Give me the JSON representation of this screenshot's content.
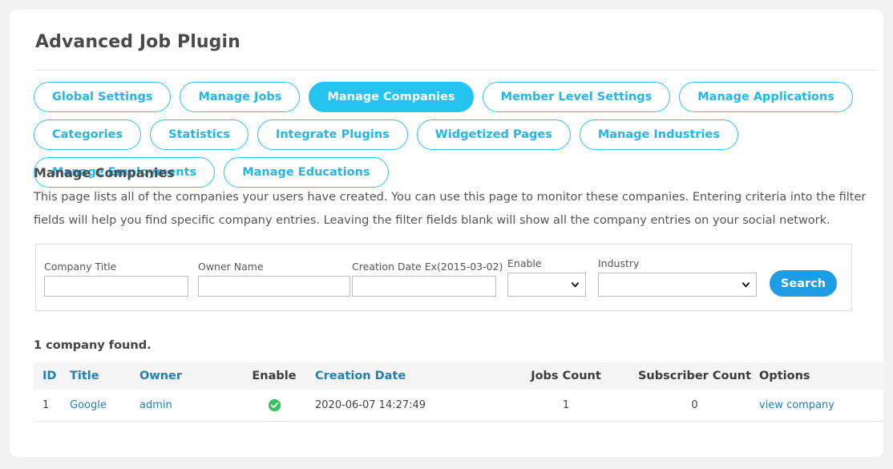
{
  "app": {
    "title": "Advanced Job Plugin"
  },
  "tabs": [
    {
      "label": "Global Settings",
      "active": false
    },
    {
      "label": "Manage Jobs",
      "active": false
    },
    {
      "label": "Manage Companies",
      "active": true
    },
    {
      "label": "Member Level Settings",
      "active": false
    },
    {
      "label": "Manage Applications",
      "active": false
    },
    {
      "label": "Categories",
      "active": false
    },
    {
      "label": "Statistics",
      "active": false
    },
    {
      "label": "Integrate Plugins",
      "active": false
    },
    {
      "label": "Widgetized Pages",
      "active": false
    },
    {
      "label": "Manage Industries",
      "active": false
    },
    {
      "label": "Manage Employments",
      "active": false
    },
    {
      "label": "Manage Educations",
      "active": false
    }
  ],
  "section": {
    "heading": "Manage Companies",
    "description": "This page lists all of the companies your users have created. You can use this page to monitor these companies. Entering criteria into the filter fields will help you find specific company entries. Leaving the filter fields blank will show all the company entries on your social network."
  },
  "filters": {
    "company_title": {
      "label": "Company Title",
      "value": "",
      "placeholder": ""
    },
    "owner_name": {
      "label": "Owner Name",
      "value": "",
      "placeholder": ""
    },
    "creation_date": {
      "label": "Creation Date Ex(2015-03-02)",
      "value": "",
      "placeholder": ""
    },
    "enable": {
      "label": "Enable",
      "selected": "",
      "options": [
        ""
      ]
    },
    "industry": {
      "label": "Industry",
      "selected": "",
      "options": [
        ""
      ]
    },
    "search_button": "Search"
  },
  "results": {
    "count_text": "1 company found.",
    "columns": [
      {
        "label": "ID",
        "is_link": true
      },
      {
        "label": "Title",
        "is_link": true
      },
      {
        "label": "Owner",
        "is_link": true
      },
      {
        "label": "Enable",
        "is_link": false
      },
      {
        "label": "Creation Date",
        "is_link": true
      },
      {
        "label": "Jobs Count",
        "is_link": false
      },
      {
        "label": "Subscriber Count",
        "is_link": false
      },
      {
        "label": "Options",
        "is_link": false
      }
    ],
    "rows": [
      {
        "id": "1",
        "title": "Google",
        "owner": "admin",
        "enable": "enabled-check-icon",
        "creation_date": "2020-06-07 14:27:49",
        "jobs_count": "1",
        "subscriber_count": "0",
        "options": "view company"
      }
    ]
  },
  "colors": {
    "accent": "#25c3f0",
    "accent_button": "#1e9de4",
    "link": "#2080b8",
    "enabled_green": "#38c25a",
    "page_background": "#f2f2f2"
  }
}
